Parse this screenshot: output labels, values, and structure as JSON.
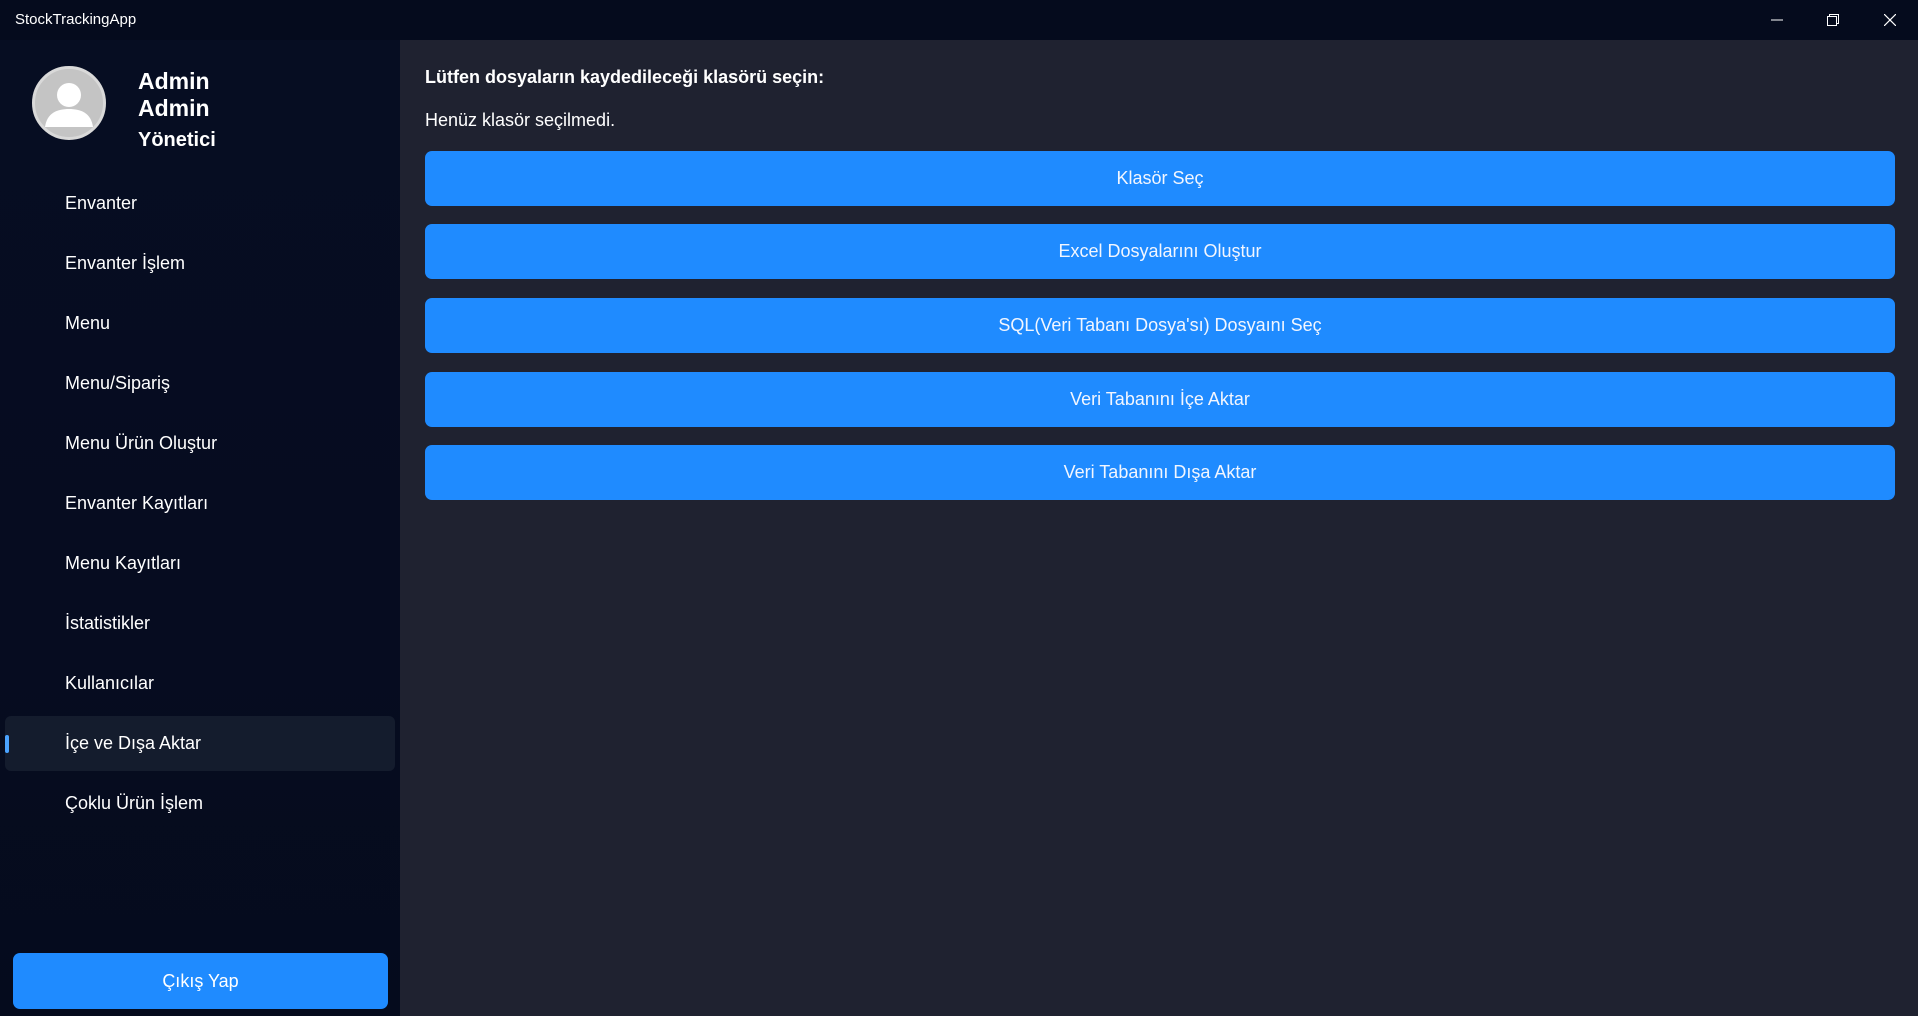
{
  "window": {
    "title": "StockTrackingApp",
    "controls": {
      "minimize_icon": "minimize-icon",
      "maximize_icon": "restore-icon",
      "close_icon": "close-icon"
    }
  },
  "user": {
    "first_name": "Admin",
    "last_name": "Admin",
    "role": "Yönetici",
    "avatar_icon": "user-avatar-icon"
  },
  "sidebar": {
    "items": [
      {
        "label": "Envanter"
      },
      {
        "label": "Envanter İşlem"
      },
      {
        "label": "Menu"
      },
      {
        "label": "Menu/Sipariş"
      },
      {
        "label": "Menu Ürün Oluştur"
      },
      {
        "label": "Envanter Kayıtları"
      },
      {
        "label": "Menu Kayıtları"
      },
      {
        "label": "İstatistikler"
      },
      {
        "label": "Kullanıcılar"
      },
      {
        "label": "İçe ve Dışa Aktar",
        "active": true
      },
      {
        "label": "Çoklu Ürün İşlem"
      }
    ],
    "logout_label": "Çıkış Yap"
  },
  "main": {
    "prompt": "Lütfen dosyaların kaydedileceği klasörü seçin:",
    "status": "Henüz klasör seçilmedi.",
    "buttons": [
      {
        "label": "Klasör Seç"
      },
      {
        "label": "Excel Dosyalarını Oluştur"
      },
      {
        "label": "SQL(Veri Tabanı Dosya'sı) Dosyaını Seç"
      },
      {
        "label": "Veri Tabanını İçe Aktar"
      },
      {
        "label": "Veri Tabanını Dışa Aktar"
      }
    ]
  },
  "colors": {
    "accent": "#1f8bff",
    "sidebar_bg": "#060d22",
    "main_bg": "#1f2230",
    "active_item_bg": "#141c2d",
    "active_indicator": "#4aa3ff"
  }
}
